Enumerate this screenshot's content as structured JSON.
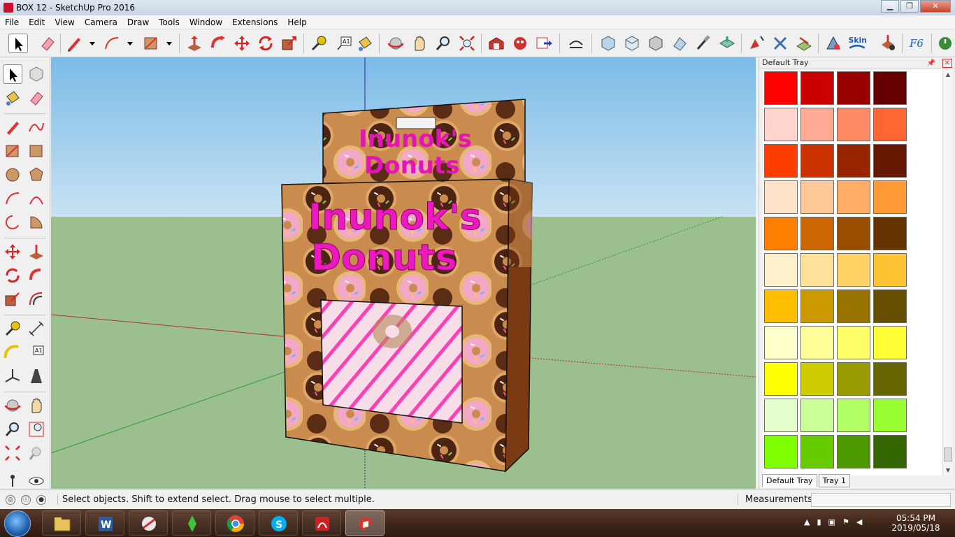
{
  "window": {
    "title": "BOX 12 - SketchUp Pro 2016",
    "controls": [
      "minimize-icon",
      "maximize-icon",
      "close-icon"
    ]
  },
  "menu": [
    "File",
    "Edit",
    "View",
    "Camera",
    "Draw",
    "Tools",
    "Window",
    "Extensions",
    "Help"
  ],
  "toolbar": {
    "tools": [
      "select-icon",
      "eraser-icon",
      "pencil-icon",
      "arc-icon",
      "rectangle-icon",
      "push-pull-icon",
      "follow-me-icon",
      "move-icon",
      "rotate-icon",
      "scale-icon",
      "tape-measure-icon",
      "text-icon",
      "paint-bucket-icon",
      "orbit-icon",
      "pan-icon",
      "zoom-icon",
      "zoom-extents-icon",
      "warehouse-icon",
      "extension-warehouse-icon",
      "send-to-layout-icon",
      "sandbox-icon",
      "iso-view-icon",
      "top-view-icon",
      "front-view-icon",
      "right-view-icon",
      "section-plane-icon",
      "solid-tools-icon",
      "skin-icon",
      "fredo-icon"
    ],
    "skin_label": "Skin",
    "fredo_label": "F6"
  },
  "tray": {
    "title": "Default Tray",
    "swatches": [
      "#ff0000",
      "#cc0000",
      "#990000",
      "#660000",
      "#ffd5cc",
      "#ffaa95",
      "#ff8a66",
      "#ff6633",
      "#ff3d00",
      "#cc3100",
      "#992400",
      "#661900",
      "#ffe4cc",
      "#ffc899",
      "#ffad66",
      "#ff9933",
      "#ff8000",
      "#cc6600",
      "#994d00",
      "#663300",
      "#fff0cc",
      "#ffe199",
      "#ffd266",
      "#ffc433",
      "#ffbf00",
      "#cc9900",
      "#997300",
      "#664d00",
      "#ffffcc",
      "#ffff99",
      "#ffff66",
      "#ffff33",
      "#ffff00",
      "#cccc00",
      "#999900",
      "#666600",
      "#e5ffcc",
      "#ccff99",
      "#b2ff66",
      "#99ff33",
      "#80ff00",
      "#66cc00",
      "#4d9900",
      "#336600"
    ],
    "tabs": [
      "Default Tray",
      "Tray 1"
    ]
  },
  "status": {
    "message": "Select objects. Shift to extend select. Drag mouse to select multiple.",
    "measurements_label": "Measurements",
    "measurements_value": ""
  },
  "model": {
    "brand_line1": "Inunok's",
    "brand_line2": "Donuts"
  },
  "taskbar": {
    "apps": [
      "file-explorer-icon",
      "word-icon",
      "sketchup-style-icon",
      "sims-icon",
      "chrome-icon",
      "skype-icon",
      "acrobat-icon",
      "sketchup-icon"
    ],
    "time": "05:54 PM",
    "date": "2019/05/18"
  }
}
